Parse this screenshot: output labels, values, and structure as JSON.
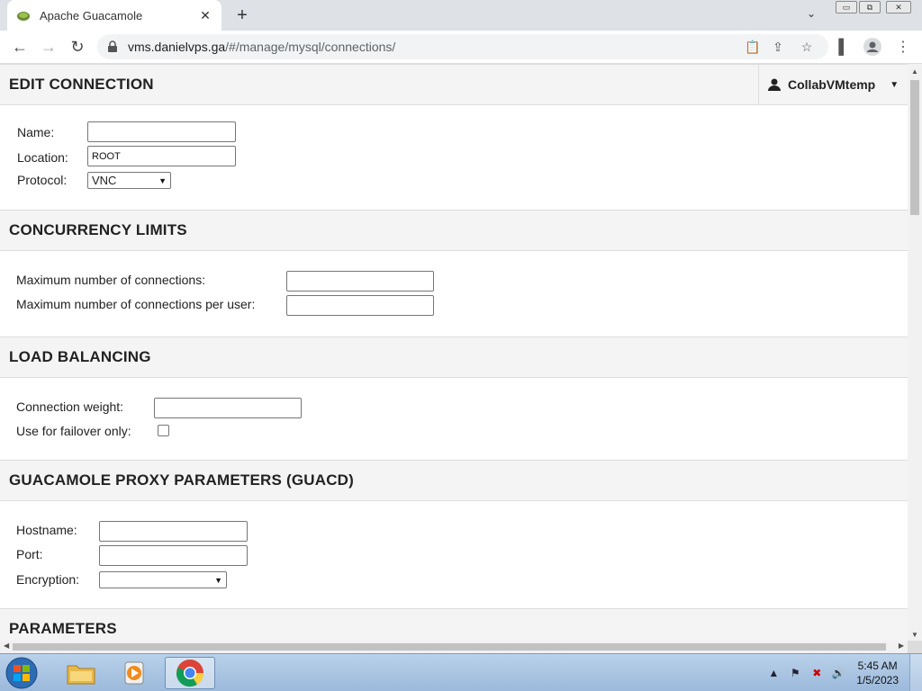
{
  "browser": {
    "tab_title": "Apache Guacamole",
    "new_tab_icon": "plus-icon",
    "url_host": "vms.danielvps.ga",
    "url_path": "/#/manage/mysql/connections/"
  },
  "header": {
    "title": "EDIT CONNECTION",
    "user": "CollabVMtemp"
  },
  "main_section": {
    "name_label": "Name:",
    "name_value": "",
    "location_label": "Location:",
    "location_value": "ROOT",
    "protocol_label": "Protocol:",
    "protocol_value": "VNC"
  },
  "concurrency": {
    "title": "CONCURRENCY LIMITS",
    "max_connections_label": "Maximum number of connections:",
    "max_connections_per_user_label": "Maximum number of connections per user:"
  },
  "load_balancing": {
    "title": "LOAD BALANCING",
    "weight_label": "Connection weight:",
    "failover_label": "Use for failover only:"
  },
  "proxy": {
    "title": "GUACAMOLE PROXY PARAMETERS (GUACD)",
    "hostname_label": "Hostname:",
    "port_label": "Port:",
    "encryption_label": "Encryption:",
    "encryption_value": ""
  },
  "parameters": {
    "title": "PARAMETERS"
  },
  "taskbar": {
    "time": "5:45 AM",
    "date": "1/5/2023"
  },
  "colors": {
    "section_bg": "#f4f4f4",
    "tabstrip_bg": "#dee1e6",
    "taskbar_bg": "#b9d1ea"
  }
}
